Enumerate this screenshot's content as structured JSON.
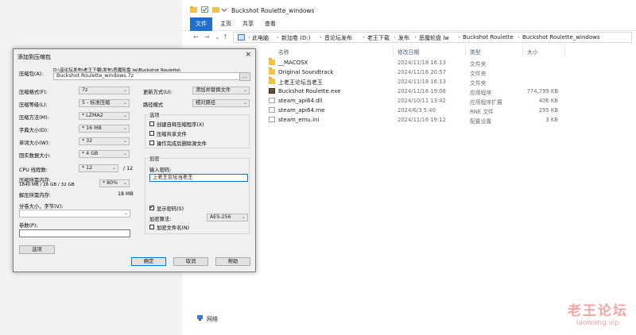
{
  "explorer": {
    "title": "Buckshot Roulette_windows",
    "ribbon": {
      "tabs": [
        "文件",
        "主页",
        "共享",
        "查看"
      ]
    },
    "address": [
      "此电脑",
      "新加卷 (D:)",
      "音论坛发布",
      "老王下载",
      "发布",
      "恶魔轮盘 lw",
      "Buckshot Roulette",
      "Buckshot Roulette_windows"
    ],
    "columns": {
      "name": "名称",
      "date": "修改日期",
      "type": "类型",
      "size": "大小"
    },
    "files": [
      {
        "name": "__MACOSX",
        "date": "2024/11/18 16:13",
        "type": "文件夹",
        "size": "",
        "icon": "folder-icon"
      },
      {
        "name": "Original Soundtrack",
        "date": "2024/11/16 20:57",
        "type": "文件夹",
        "size": "",
        "icon": "folder-icon"
      },
      {
        "name": "上老王论坛当老王",
        "date": "2024/11/18 16:13",
        "type": "文件夹",
        "size": "",
        "icon": "folder-icon"
      },
      {
        "name": "Buckshot Roulette.exe",
        "date": "2024/11/16 19:08",
        "type": "应用程序",
        "size": "774,799 KB",
        "icon": "exe-icon"
      },
      {
        "name": "steam_api64.dll",
        "date": "2024/10/11 13:42",
        "type": "应用程序扩展",
        "size": "406 KB",
        "icon": "dll-icon"
      },
      {
        "name": "steam_api64.rne",
        "date": "2024/6/3 5:40",
        "type": "RNE 文件",
        "size": "295 KB",
        "icon": "file-icon"
      },
      {
        "name": "steam_emu.ini",
        "date": "2024/11/16 19:12",
        "type": "配置设置",
        "size": "3 KB",
        "icon": "ini-icon"
      }
    ],
    "nav": {
      "network": "网络"
    },
    "watermark": {
      "main": "老王论坛",
      "url": "laowang.vip"
    }
  },
  "dialog": {
    "title": "添加到压缩包",
    "close": "×",
    "archive_label": "压缩包(A):",
    "archive_path": "D:\\音论坛发布\\老王下载\\发布\\恶魔轮盘 lw\\Buckshot Roulette\\",
    "archive_name": "Buckshot Roulette_windows.7z",
    "browse": "...",
    "format_label": "压缩格式(F):",
    "format_value": "7z",
    "level_label": "压缩等级(L):",
    "level_value": "5 - 标准压缩",
    "method_label": "压缩方法(M):",
    "method_value": "* LZMA2",
    "dict_label": "字典大小(D):",
    "dict_value": "* 16 MB",
    "word_label": "单词大小(W):",
    "word_value": "* 32",
    "solid_label": "固实数据大小:",
    "solid_value": "* 4 GB",
    "cpu_label": "CPU 线程数:",
    "cpu_value": "* 12",
    "cpu_max": "/ 12",
    "mem_comp_label": "压缩所需内存:",
    "mem_comp_detail": "1840 MB / 26 GB / 32 GB",
    "mem_comp_value": "* 80%",
    "mem_decomp_label": "解压所需内存:",
    "mem_decomp_value": "18 MB",
    "split_label": "分卷大小，字节(V):",
    "params_label": "参数(P):",
    "options_button": "选项",
    "update_label": "更新方式(U):",
    "update_value": "添加并替换文件",
    "path_label": "路径模式",
    "path_value": "相对路径",
    "options_group": "选项",
    "opt_sfx": "创建自释压缩程序(X)",
    "opt_shared": "压缩共享文件",
    "opt_delete": "操作完成后删除源文件",
    "encrypt_group": "加密",
    "password_label": "输入密码:",
    "password_value": "上老王论坛当老王",
    "show_password": "显示密码(S)",
    "enc_method_label": "加密算法:",
    "enc_method_value": "AES-256",
    "encrypt_names": "加密文件名(N)",
    "ok": "确定",
    "cancel": "取消",
    "help": "帮助"
  }
}
